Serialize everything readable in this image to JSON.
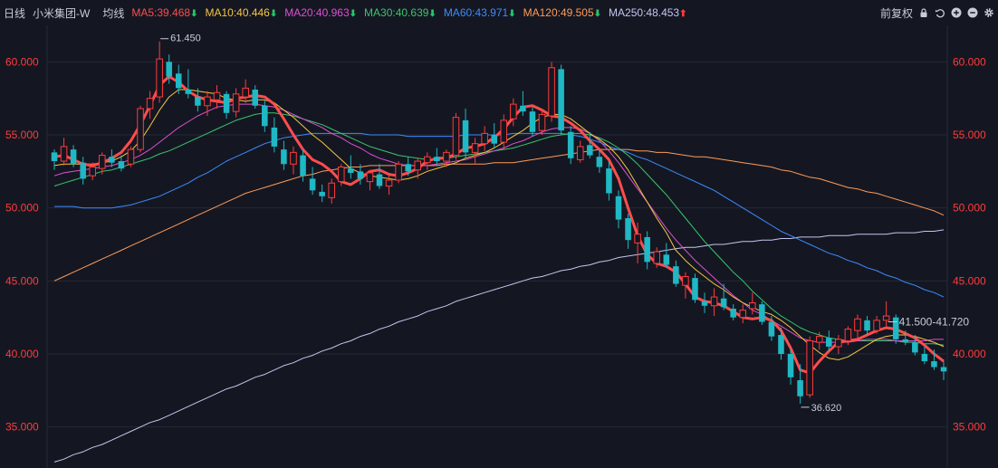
{
  "header": {
    "period": "日线",
    "symbol": "小米集团-W",
    "avg_label": "均线",
    "ma": [
      {
        "label": "MA5:39.468",
        "color": "#ff4d4d",
        "trend": "down"
      },
      {
        "label": "MA10:40.446",
        "color": "#f5c542",
        "trend": "down"
      },
      {
        "label": "MA20:40.963",
        "color": "#e04fd0",
        "trend": "down"
      },
      {
        "label": "MA30:40.639",
        "color": "#3cc46b",
        "trend": "down"
      },
      {
        "label": "MA60:43.971",
        "color": "#3d8bfd",
        "trend": "down"
      },
      {
        "label": "MA120:49.505",
        "color": "#ff9a57",
        "trend": "down"
      },
      {
        "label": "MA250:48.453",
        "color": "#c4c6ee",
        "trend": "up"
      }
    ],
    "adjust": "前复权",
    "arrow_down_glyph": "⬇",
    "arrow_up_glyph": "⬆"
  },
  "icons": [
    "lock-icon",
    "undo-icon",
    "zoom-in-icon",
    "zoom-out-icon",
    "settings-icon"
  ],
  "chart_data": {
    "type": "candlestick",
    "ylim": [
      32.5,
      62.5
    ],
    "yticks": [
      "35.000",
      "40.000",
      "45.000",
      "50.000",
      "55.000",
      "60.000"
    ],
    "y_tick_values": [
      35,
      40,
      45,
      50,
      55,
      60
    ],
    "grid": true,
    "annotations": {
      "high": "61.450",
      "low": "36.620",
      "range": "41.500-41.720"
    },
    "colors": {
      "up": "#ff3b3b",
      "down": "#1fb8c4",
      "grid": "#252a36",
      "axis_text": "#ff3b3b"
    },
    "series": [
      {
        "name": "MA5",
        "color": "#ff4d4d",
        "width": 3,
        "values": [
          53.5,
          53.6,
          53.3,
          53.0,
          52.9,
          53.1,
          53.4,
          53.8,
          54.6,
          55.7,
          57.0,
          58.4,
          59.0,
          58.6,
          58.0,
          57.6,
          57.4,
          57.3,
          57.2,
          57.5,
          57.6,
          57.7,
          57.6,
          57.1,
          56.1,
          55.0,
          54.0,
          53.3,
          53.0,
          52.5,
          51.8,
          51.6,
          52.0,
          52.5,
          52.6,
          52.3,
          52.2,
          52.4,
          52.7,
          53.2,
          53.4,
          53.4,
          53.7,
          54.1,
          54.2,
          54.4,
          54.8,
          55.4,
          56.2,
          56.9,
          57.0,
          56.7,
          56.3,
          56.2,
          55.8,
          55.3,
          54.6,
          54.0,
          53.3,
          52.0,
          50.0,
          48.1,
          46.8,
          46.2,
          46.0,
          45.6,
          44.8,
          43.9,
          43.6,
          43.5,
          43.3,
          42.9,
          42.5,
          42.4,
          42.5,
          42.3,
          41.6,
          40.4,
          38.9,
          38.7,
          39.5,
          40.2,
          40.8,
          40.9,
          41.0,
          41.3,
          41.6,
          41.8,
          41.7,
          41.4,
          41.1,
          40.6,
          40.0,
          39.5
        ]
      },
      {
        "name": "MA10",
        "color": "#f5c542",
        "width": 1,
        "values": [
          52.9,
          53.0,
          53.0,
          53.0,
          53.0,
          53.1,
          53.2,
          53.5,
          53.9,
          54.6,
          55.6,
          56.7,
          57.6,
          58.1,
          58.1,
          58.0,
          57.9,
          57.8,
          57.5,
          57.4,
          57.3,
          57.4,
          57.4,
          57.2,
          56.7,
          56.2,
          55.6,
          55.0,
          54.5,
          53.9,
          53.3,
          52.7,
          52.4,
          52.2,
          52.1,
          52.0,
          51.9,
          52.0,
          52.2,
          52.5,
          52.7,
          52.9,
          53.1,
          53.4,
          53.6,
          53.8,
          54.1,
          54.5,
          54.9,
          55.3,
          55.8,
          56.2,
          56.4,
          56.4,
          56.1,
          55.6,
          55.1,
          54.7,
          54.2,
          53.5,
          52.6,
          51.5,
          50.4,
          49.3,
          48.3,
          47.1,
          46.4,
          45.8,
          45.3,
          44.8,
          44.4,
          43.9,
          43.5,
          43.2,
          42.9,
          42.7,
          42.3,
          41.8,
          41.2,
          40.6,
          40.1,
          39.7,
          39.6,
          39.8,
          40.2,
          40.6,
          41.0,
          41.2,
          41.3,
          41.3,
          41.2,
          41.0,
          40.8,
          40.5
        ]
      },
      {
        "name": "MA20",
        "color": "#e04fd0",
        "width": 1,
        "values": [
          52.2,
          52.4,
          52.5,
          52.6,
          52.7,
          52.8,
          52.9,
          53.1,
          53.3,
          53.6,
          54.0,
          54.5,
          55.0,
          55.5,
          55.9,
          56.3,
          56.6,
          56.9,
          57.0,
          57.1,
          57.1,
          57.1,
          57.0,
          56.9,
          56.7,
          56.4,
          56.1,
          55.8,
          55.5,
          55.1,
          54.8,
          54.4,
          54.1,
          53.7,
          53.4,
          53.2,
          53.0,
          52.9,
          52.9,
          52.9,
          53.0,
          53.1,
          53.2,
          53.3,
          53.5,
          53.7,
          53.9,
          54.1,
          54.4,
          54.6,
          54.9,
          55.2,
          55.4,
          55.5,
          55.5,
          55.4,
          55.1,
          54.6,
          53.9,
          53.1,
          52.2,
          51.3,
          50.4,
          49.5,
          48.6,
          47.8,
          47.1,
          46.4,
          45.8,
          45.2,
          44.6,
          44.0,
          43.5,
          43.0,
          42.7,
          42.3,
          41.9,
          41.5,
          41.1,
          40.9,
          40.8,
          40.8,
          40.8,
          40.8,
          40.9,
          41.0,
          41.0,
          41.0,
          40.9,
          40.9,
          40.9,
          40.9,
          41.0,
          41.0
        ]
      },
      {
        "name": "MA30",
        "color": "#3cc46b",
        "width": 1,
        "values": [
          51.5,
          51.7,
          51.9,
          52.1,
          52.3,
          52.5,
          52.6,
          52.8,
          53.0,
          53.2,
          53.4,
          53.7,
          53.9,
          54.2,
          54.5,
          54.8,
          55.1,
          55.4,
          55.7,
          56.0,
          56.2,
          56.4,
          56.5,
          56.5,
          56.4,
          56.3,
          56.1,
          55.9,
          55.7,
          55.4,
          55.1,
          54.8,
          54.5,
          54.2,
          54.0,
          53.8,
          53.6,
          53.5,
          53.4,
          53.3,
          53.3,
          53.4,
          53.5,
          53.6,
          53.7,
          53.8,
          53.9,
          54.0,
          54.1,
          54.3,
          54.5,
          54.7,
          54.9,
          55.0,
          55.1,
          55.1,
          55.0,
          54.8,
          54.5,
          54.1,
          53.6,
          53.0,
          52.3,
          51.6,
          50.9,
          50.1,
          49.3,
          48.5,
          47.7,
          47.0,
          46.3,
          45.6,
          45.0,
          44.3,
          43.7,
          43.1,
          42.6,
          42.2,
          41.8,
          41.5,
          41.3,
          41.1,
          41.0,
          40.9,
          40.9,
          40.9,
          40.9,
          40.9,
          40.9,
          40.8,
          40.8,
          40.7,
          40.7,
          40.6
        ]
      },
      {
        "name": "MA60",
        "color": "#3d8bfd",
        "width": 1,
        "values": [
          50.1,
          50.1,
          50.1,
          50.0,
          50.0,
          50.0,
          50.0,
          50.1,
          50.2,
          50.4,
          50.6,
          50.8,
          51.1,
          51.4,
          51.7,
          52.1,
          52.4,
          52.8,
          53.2,
          53.5,
          53.8,
          54.1,
          54.4,
          54.6,
          54.8,
          54.9,
          55.0,
          55.1,
          55.1,
          55.1,
          55.1,
          55.1,
          55.1,
          55.0,
          55.0,
          55.0,
          55.0,
          54.9,
          54.9,
          54.9,
          54.9,
          54.9,
          54.9,
          55.0,
          55.0,
          55.0,
          55.0,
          55.0,
          55.1,
          55.1,
          55.1,
          55.1,
          55.1,
          55.1,
          55.0,
          54.9,
          54.7,
          54.5,
          54.2,
          54.0,
          53.8,
          53.5,
          53.3,
          53.0,
          52.7,
          52.4,
          52.1,
          51.8,
          51.5,
          51.2,
          50.8,
          50.4,
          50.0,
          49.6,
          49.2,
          48.8,
          48.4,
          48.1,
          47.8,
          47.5,
          47.2,
          46.9,
          46.7,
          46.4,
          46.2,
          45.9,
          45.7,
          45.4,
          45.2,
          44.9,
          44.7,
          44.4,
          44.2,
          43.9
        ]
      },
      {
        "name": "MA120",
        "color": "#ff9a57",
        "width": 1,
        "values": [
          45.0,
          45.3,
          45.6,
          45.9,
          46.2,
          46.5,
          46.8,
          47.1,
          47.4,
          47.7,
          48.0,
          48.3,
          48.6,
          48.9,
          49.2,
          49.5,
          49.8,
          50.1,
          50.4,
          50.7,
          51.0,
          51.2,
          51.4,
          51.6,
          51.8,
          52.0,
          52.2,
          52.3,
          52.5,
          52.6,
          52.7,
          52.8,
          52.8,
          52.9,
          52.9,
          52.9,
          52.9,
          52.9,
          52.9,
          52.9,
          52.9,
          53.0,
          53.0,
          53.0,
          53.0,
          53.0,
          53.1,
          53.1,
          53.1,
          53.2,
          53.3,
          53.4,
          53.5,
          53.6,
          53.7,
          53.8,
          53.9,
          54.0,
          54.0,
          54.0,
          54.0,
          53.9,
          53.9,
          53.8,
          53.8,
          53.7,
          53.6,
          53.5,
          53.5,
          53.4,
          53.3,
          53.2,
          53.1,
          53.0,
          52.9,
          52.8,
          52.6,
          52.5,
          52.3,
          52.1,
          52.0,
          51.8,
          51.6,
          51.4,
          51.3,
          51.1,
          51.0,
          50.8,
          50.6,
          50.4,
          50.2,
          50.0,
          49.8,
          49.5
        ]
      },
      {
        "name": "MA250",
        "color": "#c4c6ee",
        "width": 1,
        "values": [
          32.6,
          32.8,
          33.1,
          33.3,
          33.6,
          33.8,
          34.1,
          34.4,
          34.7,
          35.0,
          35.3,
          35.5,
          35.8,
          36.1,
          36.4,
          36.7,
          37.0,
          37.3,
          37.6,
          37.8,
          38.1,
          38.4,
          38.6,
          38.9,
          39.2,
          39.4,
          39.7,
          39.9,
          40.2,
          40.4,
          40.7,
          40.9,
          41.2,
          41.4,
          41.7,
          41.9,
          42.2,
          42.4,
          42.6,
          42.9,
          43.1,
          43.3,
          43.6,
          43.8,
          44.0,
          44.2,
          44.4,
          44.6,
          44.8,
          45.0,
          45.2,
          45.3,
          45.5,
          45.7,
          45.8,
          46.0,
          46.1,
          46.3,
          46.4,
          46.6,
          46.7,
          46.8,
          46.9,
          47.0,
          47.1,
          47.2,
          47.3,
          47.3,
          47.4,
          47.5,
          47.5,
          47.6,
          47.7,
          47.7,
          47.8,
          47.8,
          47.9,
          47.9,
          48.0,
          48.0,
          48.0,
          48.1,
          48.1,
          48.1,
          48.2,
          48.2,
          48.2,
          48.2,
          48.3,
          48.3,
          48.3,
          48.4,
          48.4,
          48.5
        ]
      }
    ],
    "candles": [
      [
        53.8,
        54.0,
        52.6,
        53.2
      ],
      [
        53.2,
        54.8,
        52.9,
        54.2
      ],
      [
        54.0,
        54.3,
        52.8,
        53.0
      ],
      [
        53.1,
        53.5,
        51.6,
        52.0
      ],
      [
        52.2,
        53.1,
        51.9,
        52.8
      ],
      [
        52.7,
        53.8,
        52.3,
        53.6
      ],
      [
        53.5,
        54.0,
        52.8,
        53.1
      ],
      [
        53.2,
        53.6,
        52.5,
        52.7
      ],
      [
        53.0,
        54.2,
        52.8,
        54.0
      ],
      [
        54.0,
        57.0,
        53.8,
        56.8
      ],
      [
        56.8,
        58.0,
        56.1,
        57.5
      ],
      [
        57.6,
        61.4,
        57.2,
        60.2
      ],
      [
        60.0,
        60.5,
        58.5,
        59.0
      ],
      [
        59.2,
        59.8,
        57.8,
        58.2
      ],
      [
        58.1,
        59.5,
        57.5,
        57.8
      ],
      [
        57.6,
        58.2,
        56.6,
        57.0
      ],
      [
        57.0,
        58.0,
        56.3,
        57.6
      ],
      [
        57.4,
        58.4,
        56.8,
        57.9
      ],
      [
        57.8,
        58.0,
        56.1,
        56.5
      ],
      [
        56.6,
        58.2,
        56.2,
        57.8
      ],
      [
        57.6,
        58.8,
        57.2,
        58.2
      ],
      [
        58.1,
        58.4,
        56.8,
        57.0
      ],
      [
        57.0,
        57.4,
        55.2,
        55.6
      ],
      [
        55.5,
        56.2,
        53.8,
        54.2
      ],
      [
        54.0,
        54.6,
        52.6,
        53.0
      ],
      [
        53.0,
        54.2,
        52.3,
        53.8
      ],
      [
        53.6,
        54.0,
        51.8,
        52.2
      ],
      [
        52.0,
        52.8,
        50.9,
        51.2
      ],
      [
        51.1,
        51.6,
        50.4,
        50.8
      ],
      [
        50.7,
        52.0,
        50.3,
        51.7
      ],
      [
        51.8,
        53.0,
        51.5,
        52.8
      ],
      [
        52.7,
        53.6,
        52.0,
        52.4
      ],
      [
        52.5,
        53.0,
        51.6,
        52.0
      ],
      [
        51.8,
        52.6,
        51.2,
        52.4
      ],
      [
        52.3,
        53.0,
        51.3,
        51.5
      ],
      [
        51.5,
        52.2,
        50.9,
        51.9
      ],
      [
        51.9,
        53.2,
        51.7,
        53.0
      ],
      [
        53.0,
        53.5,
        52.2,
        52.5
      ],
      [
        52.6,
        53.4,
        52.0,
        53.2
      ],
      [
        53.1,
        53.8,
        52.6,
        53.5
      ],
      [
        53.5,
        54.1,
        52.9,
        53.2
      ],
      [
        53.2,
        54.0,
        52.8,
        53.8
      ],
      [
        53.6,
        56.5,
        53.3,
        56.2
      ],
      [
        56.0,
        56.8,
        53.4,
        53.8
      ],
      [
        53.8,
        54.8,
        53.0,
        54.4
      ],
      [
        54.4,
        55.6,
        53.9,
        55.1
      ],
      [
        55.0,
        55.8,
        54.1,
        54.4
      ],
      [
        54.5,
        56.4,
        54.0,
        56.0
      ],
      [
        56.1,
        57.5,
        55.6,
        57.1
      ],
      [
        57.0,
        58.0,
        56.3,
        56.6
      ],
      [
        56.6,
        56.9,
        54.9,
        55.2
      ],
      [
        55.3,
        56.7,
        55.0,
        56.4
      ],
      [
        56.3,
        60.0,
        55.9,
        59.6
      ],
      [
        59.5,
        59.8,
        55.0,
        55.3
      ],
      [
        55.2,
        55.6,
        53.0,
        53.4
      ],
      [
        53.3,
        54.6,
        53.1,
        54.2
      ],
      [
        54.3,
        55.2,
        53.4,
        53.6
      ],
      [
        53.5,
        54.0,
        52.4,
        52.8
      ],
      [
        52.7,
        53.2,
        50.5,
        51.0
      ],
      [
        50.8,
        51.2,
        48.6,
        49.2
      ],
      [
        49.3,
        49.6,
        47.2,
        47.8
      ],
      [
        47.6,
        49.0,
        46.2,
        48.2
      ],
      [
        48.0,
        48.4,
        45.8,
        46.3
      ],
      [
        46.2,
        47.3,
        45.9,
        47.0
      ],
      [
        46.8,
        47.6,
        45.9,
        46.1
      ],
      [
        46.0,
        46.4,
        44.6,
        44.8
      ],
      [
        44.7,
        45.6,
        43.8,
        45.3
      ],
      [
        45.2,
        45.5,
        43.5,
        43.7
      ],
      [
        43.6,
        44.2,
        42.8,
        43.3
      ],
      [
        43.3,
        44.5,
        42.6,
        43.9
      ],
      [
        43.8,
        44.8,
        43.0,
        43.2
      ],
      [
        43.1,
        43.4,
        42.3,
        42.5
      ],
      [
        42.5,
        43.4,
        42.1,
        43.0
      ],
      [
        43.1,
        44.2,
        42.7,
        43.5
      ],
      [
        43.4,
        43.6,
        42.0,
        42.2
      ],
      [
        42.2,
        42.6,
        40.9,
        41.2
      ],
      [
        41.3,
        41.8,
        39.6,
        40.0
      ],
      [
        40.0,
        40.3,
        37.9,
        38.4
      ],
      [
        38.2,
        39.3,
        36.6,
        37.1
      ],
      [
        37.2,
        41.2,
        37.0,
        40.9
      ],
      [
        40.8,
        41.5,
        40.3,
        41.2
      ],
      [
        41.1,
        41.6,
        40.2,
        40.5
      ],
      [
        40.5,
        41.3,
        40.0,
        41.0
      ],
      [
        40.9,
        41.9,
        40.6,
        41.7
      ],
      [
        41.6,
        42.7,
        41.1,
        42.4
      ],
      [
        42.3,
        42.6,
        41.3,
        41.6
      ],
      [
        41.6,
        42.6,
        41.4,
        42.3
      ],
      [
        42.3,
        43.6,
        41.9,
        42.6
      ],
      [
        42.5,
        42.7,
        40.7,
        41.0
      ],
      [
        41.0,
        41.6,
        40.6,
        40.8
      ],
      [
        40.8,
        41.3,
        39.9,
        40.1
      ],
      [
        40.0,
        40.5,
        39.3,
        39.5
      ],
      [
        39.5,
        40.3,
        38.9,
        39.1
      ],
      [
        39.1,
        39.5,
        38.2,
        38.8
      ]
    ]
  }
}
